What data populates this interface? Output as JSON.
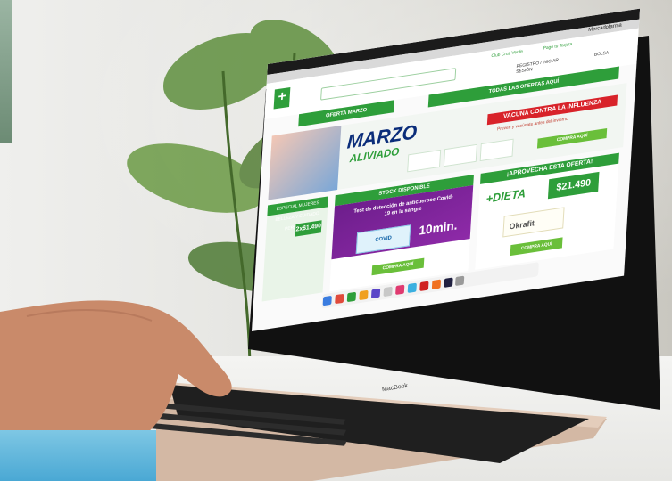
{
  "scene": {
    "description_labels": {
      "laptop_brand": "MacBook"
    }
  },
  "website": {
    "menubar_title": "Mercadofarma",
    "header": {
      "club_label": "Club Cruz Verde",
      "pay_label": "Pago tu Tarjeta",
      "register_label": "REGISTRO / INICIAR SESIÓN",
      "cart_label": "BOLSA"
    },
    "nav": {
      "left_label": "OFERTA MARZO",
      "right_label": "TODAS LAS OFERTAS AQUÍ"
    },
    "banner": {
      "title_line1": "MARZO",
      "title_line2": "ALIVIADO",
      "vacuna_title": "VACUNA CONTRA LA INFLUENZA",
      "vacuna_sub": "Prevén y vacúnate antes del invierno",
      "button": "COMPRA AQUÍ"
    },
    "cards": [
      {
        "header": "ESPECIAL MUJERES BELLEZA Y CUIDADO PERSONAL",
        "price": "2x$1.490"
      },
      {
        "header": "STOCK DISPONIBLE",
        "title": "Test de detección de anticuerpos Covid-19 en la sangre",
        "box_label": "COVID",
        "time": "10min.",
        "button": "COMPRA AQUÍ"
      },
      {
        "header": "¡APROVECHA ESTA OFERTA!",
        "brand": "+DIETA",
        "price": "$21.490",
        "product": "Okrafit",
        "button": "COMPRA AQUÍ"
      }
    ]
  },
  "colors": {
    "brand_green": "#2e9e3a",
    "accent_red": "#d8232a",
    "purple": "#7a2396",
    "navy": "#0b2d7a"
  }
}
